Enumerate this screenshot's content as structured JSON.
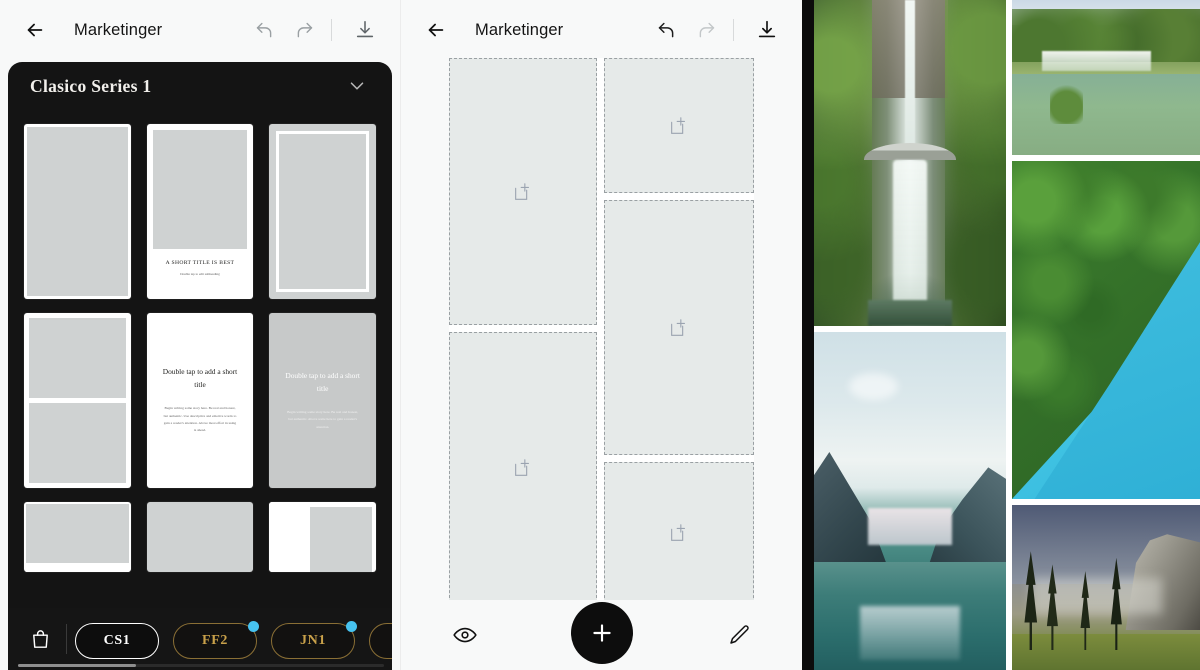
{
  "panel1": {
    "topbar": {
      "title": "Marketinger",
      "back_icon": "arrow-left-icon",
      "undo_icon": "undo-icon",
      "redo_icon": "redo-icon",
      "download_icon": "download-icon"
    },
    "sheet": {
      "title": "Clasico Series 1",
      "collapse_icon": "chevron-down-icon"
    },
    "templates": [
      {
        "id": "tpl-1",
        "kind": "photo-full"
      },
      {
        "id": "tpl-2",
        "kind": "photo-caption",
        "title": "A SHORT TITLE IS BEST",
        "subtitle": "Double tap to edit subheading"
      },
      {
        "id": "tpl-3",
        "kind": "photo-framed"
      },
      {
        "id": "tpl-4",
        "kind": "photo-split-2"
      },
      {
        "id": "tpl-5",
        "kind": "text-light",
        "title": "Double tap to add a short title",
        "body": "Begin writing some story here. Be real and honest, but authentic. Use descriptive and emotive words to gain a reader's attention. Above most effort in using is ahead."
      },
      {
        "id": "tpl-6",
        "kind": "text-dark",
        "title": "Double tap to add a short title",
        "body": "Begin writing some story here. Be real and honest, but authentic. Above some here to gain a reader's attention."
      },
      {
        "id": "tpl-7",
        "kind": "photo-band"
      },
      {
        "id": "tpl-8",
        "kind": "photo-plain"
      },
      {
        "id": "tpl-9",
        "kind": "photo-offset"
      }
    ],
    "chipbar": {
      "bag_icon": "shopping-bag-icon",
      "chips": [
        {
          "label": "CS1",
          "selected": true,
          "badge": false
        },
        {
          "label": "FF2",
          "selected": false,
          "badge": true
        },
        {
          "label": "JN1",
          "selected": false,
          "badge": true
        }
      ]
    }
  },
  "panel2": {
    "topbar": {
      "title": "Marketinger",
      "back_icon": "arrow-left-icon",
      "undo_icon": "undo-icon",
      "redo_icon": "redo-icon",
      "download_icon": "download-icon"
    },
    "canvas": {
      "left_cells": [
        {
          "id": "cell-1",
          "placeholder_icon": "add-photo-icon",
          "has_icon": true
        },
        {
          "id": "cell-2",
          "placeholder_icon": "add-photo-icon",
          "has_icon": true
        }
      ],
      "right_cells": [
        {
          "id": "cell-3",
          "placeholder_icon": "add-photo-icon",
          "has_icon": true
        },
        {
          "id": "cell-4",
          "placeholder_icon": "add-photo-icon",
          "has_icon": true
        },
        {
          "id": "cell-5",
          "placeholder_icon": "add-photo-icon",
          "has_icon": true
        }
      ]
    },
    "bottombar": {
      "preview_icon": "eye-icon",
      "add_icon": "plus-icon",
      "edit_icon": "pencil-icon"
    }
  },
  "panel3": {
    "photos": [
      {
        "id": "photo-multnomah-falls",
        "alt": "Tall waterfall with footbridge in lush green gorge",
        "column": "left"
      },
      {
        "id": "photo-mountain-lake",
        "alt": "Mountain lake with reflection and snowy peaks",
        "column": "left"
      },
      {
        "id": "photo-krka-cascades",
        "alt": "Wide cascading waterfalls over mossy river",
        "column": "right"
      },
      {
        "id": "photo-aerial-forest-lagoon",
        "alt": "Aerial view of dense forest beside turquoise water",
        "column": "right"
      },
      {
        "id": "photo-yosemite-valley",
        "alt": "Granite cliff with tall pine trees at dusk",
        "column": "right"
      }
    ]
  },
  "colors": {
    "accent_badge": "#47c3f0",
    "chip_gold": "#c9a14a",
    "sheet_bg": "#141414",
    "canvas_cell": "#e6eae9",
    "app_bg": "#f8f9f9"
  }
}
